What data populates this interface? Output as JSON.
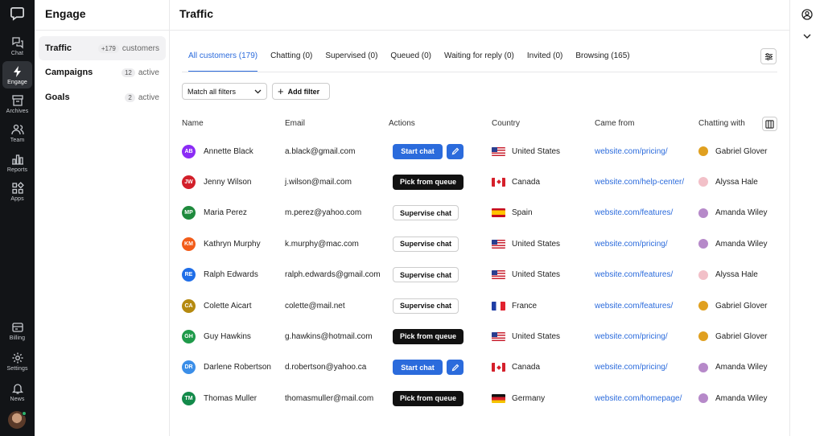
{
  "rail": {
    "items": [
      {
        "label": "Chat",
        "icon": "chat-icon"
      },
      {
        "label": "Engage",
        "icon": "lightning-icon",
        "active": true
      },
      {
        "label": "Archives",
        "icon": "archive-icon"
      },
      {
        "label": "Team",
        "icon": "team-icon"
      },
      {
        "label": "Reports",
        "icon": "reports-icon"
      },
      {
        "label": "Apps",
        "icon": "apps-icon"
      }
    ],
    "bottom": [
      {
        "label": "Billing",
        "icon": "billing-icon"
      },
      {
        "label": "Settings",
        "icon": "gear-icon"
      },
      {
        "label": "News",
        "icon": "bell-icon"
      }
    ]
  },
  "secnav": {
    "title": "Engage",
    "items": [
      {
        "label": "Traffic",
        "badge": "+179",
        "meta": "customers"
      },
      {
        "label": "Campaigns",
        "badge": "12",
        "meta": "active"
      },
      {
        "label": "Goals",
        "badge": "2",
        "meta": "active"
      }
    ]
  },
  "main": {
    "title": "Traffic",
    "tabs": [
      "All customers (179)",
      "Chatting (0)",
      "Supervised (0)",
      "Queued (0)",
      "Waiting for reply (0)",
      "Invited (0)",
      "Browsing (165)"
    ],
    "filter_select": "Match all filters",
    "add_filter": "Add filter",
    "columns": {
      "name": "Name",
      "email": "Email",
      "actions": "Actions",
      "country": "Country",
      "came_from": "Came from",
      "chatting_with": "Chatting with"
    },
    "rows": [
      {
        "initials": "AB",
        "color": "#8b2cf5",
        "name": "Annette Black",
        "email": "a.black@gmail.com",
        "action": "Start chat",
        "country": "United States",
        "flag": "us",
        "source": "website.com/pricing/",
        "agent": "Gabriel Glover",
        "agent_color": "#e0a020"
      },
      {
        "initials": "JW",
        "color": "#d21f2a",
        "name": "Jenny Wilson",
        "email": "j.wilson@mail.com",
        "action": "Pick from queue",
        "country": "Canada",
        "flag": "ca",
        "source": "website.com/help-center/",
        "agent": "Alyssa Hale",
        "agent_color": "#f2c0c8"
      },
      {
        "initials": "MP",
        "color": "#1f8a3d",
        "name": "Maria Perez",
        "email": "m.perez@yahoo.com",
        "action": "Supervise chat",
        "country": "Spain",
        "flag": "es",
        "source": "website.com/features/",
        "agent": "Amanda Wiley",
        "agent_color": "#b689c9"
      },
      {
        "initials": "KM",
        "color": "#f25c19",
        "name": "Kathryn Murphy",
        "email": "k.murphy@mac.com",
        "action": "Supervise chat",
        "country": "United States",
        "flag": "us",
        "source": "website.com/pricing/",
        "agent": "Amanda Wiley",
        "agent_color": "#b689c9"
      },
      {
        "initials": "RE",
        "color": "#1f6ee8",
        "name": "Ralph Edwards",
        "email": "ralph.edwards@gmail.com",
        "action": "Supervise chat",
        "country": "United States",
        "flag": "us",
        "source": "website.com/features/",
        "agent": "Alyssa Hale",
        "agent_color": "#f2c0c8"
      },
      {
        "initials": "CA",
        "color": "#b58a10",
        "name": "Colette Aicart",
        "email": "colette@mail.net",
        "action": "Supervise chat",
        "country": "France",
        "flag": "fr",
        "source": "website.com/features/",
        "agent": "Gabriel Glover",
        "agent_color": "#e0a020"
      },
      {
        "initials": "GH",
        "color": "#1f9a4a",
        "name": "Guy Hawkins",
        "email": "g.hawkins@hotmail.com",
        "action": "Pick from queue",
        "country": "United States",
        "flag": "us",
        "source": "website.com/pricing/",
        "agent": "Gabriel Glover",
        "agent_color": "#e0a020"
      },
      {
        "initials": "DR",
        "color": "#3b8ee8",
        "name": "Darlene Robertson",
        "email": "d.robertson@yahoo.ca",
        "action": "Start chat",
        "country": "Canada",
        "flag": "ca",
        "source": "website.com/pricing/",
        "agent": "Amanda Wiley",
        "agent_color": "#b689c9"
      },
      {
        "initials": "TM",
        "color": "#138a4a",
        "name": "Thomas Muller",
        "email": "thomasmuller@mail.com",
        "action": "Pick from queue",
        "country": "Germany",
        "flag": "de",
        "source": "website.com/homepage/",
        "agent": "Amanda Wiley",
        "agent_color": "#b689c9"
      }
    ]
  }
}
